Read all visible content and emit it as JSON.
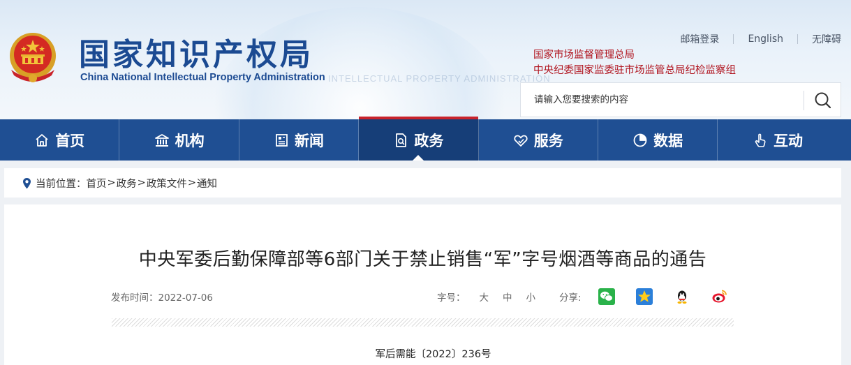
{
  "header": {
    "brand_cn": "国家知识产权局",
    "brand_en": "China National Intellectual Property Administration",
    "watermark": "INTELLECTUAL PROPERTY ADMINISTRATION",
    "toplinks": [
      "邮箱登录",
      "English",
      "无障碍"
    ],
    "red_links": [
      "国家市场监督管理总局",
      "中央纪委国家监委驻市场监管总局纪检监察组"
    ],
    "search_placeholder": "请输入您要搜索的内容"
  },
  "nav": {
    "items": [
      {
        "label": "首页",
        "icon": "home-icon"
      },
      {
        "label": "机构",
        "icon": "building-icon"
      },
      {
        "label": "新闻",
        "icon": "newspaper-icon"
      },
      {
        "label": "政务",
        "icon": "document-icon",
        "active": true
      },
      {
        "label": "服务",
        "icon": "heart-hand-icon"
      },
      {
        "label": "数据",
        "icon": "pie-chart-icon"
      },
      {
        "label": "互动",
        "icon": "hand-pointer-icon"
      }
    ]
  },
  "breadcrumb": {
    "prefix": "当前位置：",
    "items": [
      "首页",
      "政务",
      "政策文件",
      "通知"
    ],
    "separator": ">"
  },
  "article": {
    "title": "中央军委后勤保障部等6部门关于禁止销售“军”字号烟酒等商品的通告",
    "date_label": "发布时间：2022-07-06",
    "font_label": "字号：",
    "font_sizes": [
      "大",
      "中",
      "小"
    ],
    "share_label": "分享:",
    "share_icons": [
      "wechat-icon",
      "qzone-icon",
      "qq-icon",
      "weibo-icon"
    ],
    "doc_number": "军后需能〔2022〕236号"
  },
  "colors": {
    "nav_bg": "#1f4f93",
    "nav_active": "#163e78",
    "accent_red": "#c8232c",
    "brand_blue": "#1b4a92"
  }
}
